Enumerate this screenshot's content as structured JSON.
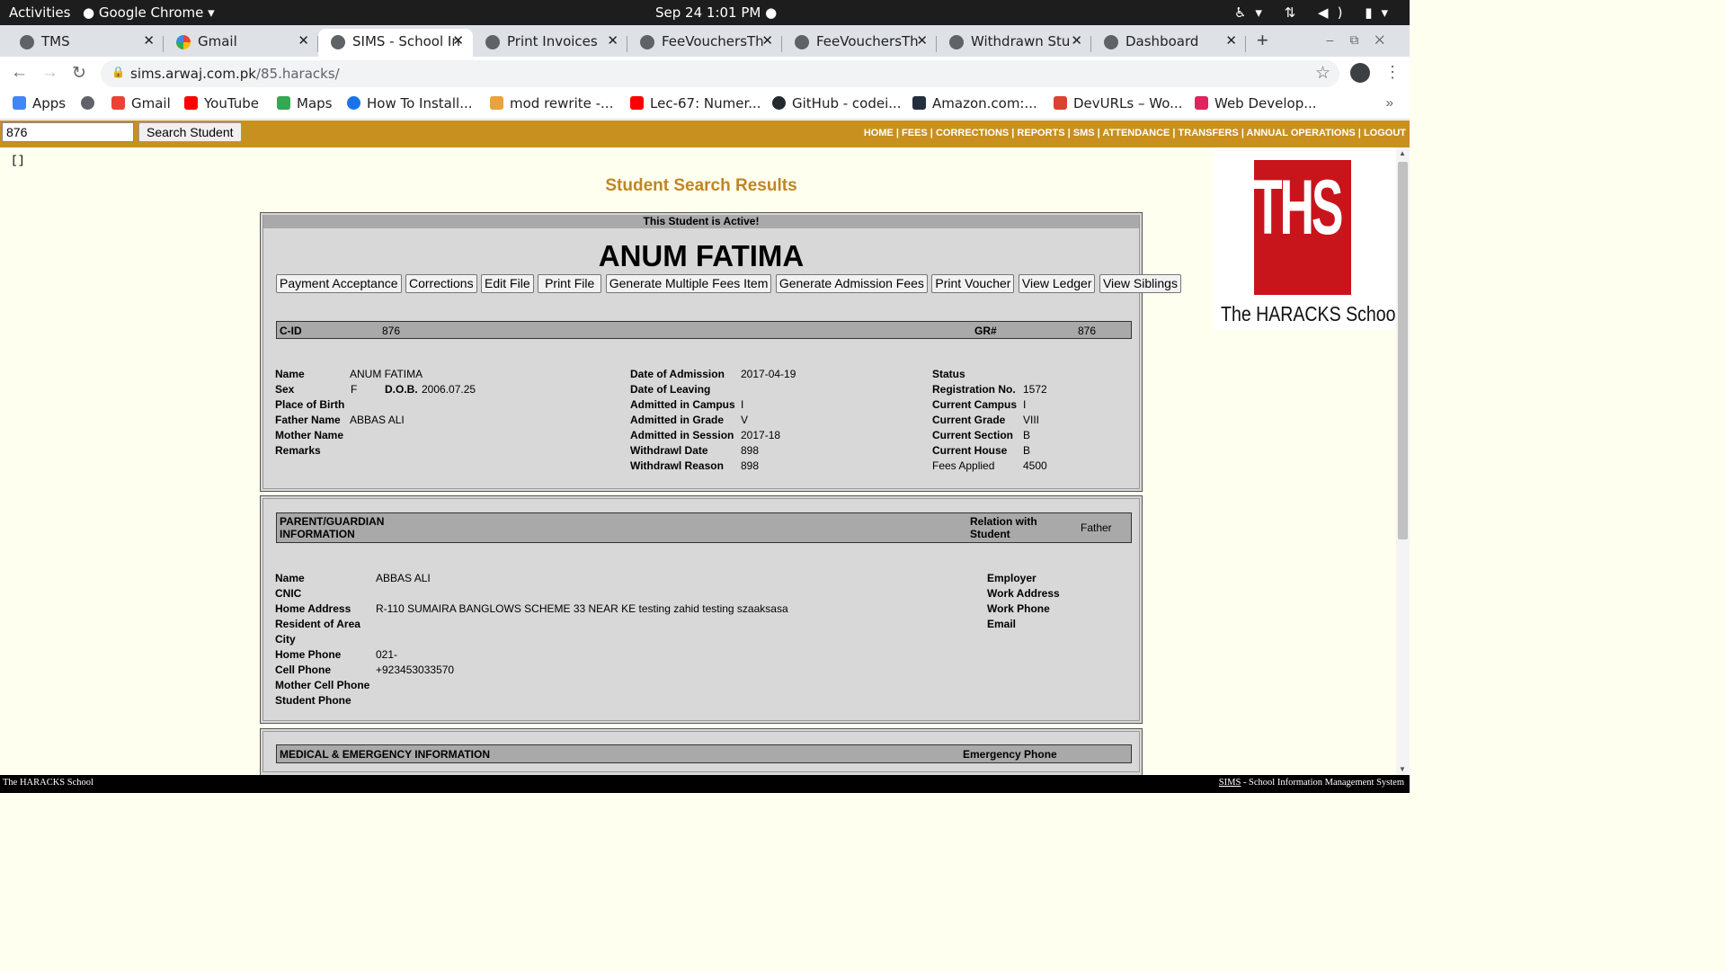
{
  "system": {
    "activities": "Activities",
    "app_name": "Google Chrome",
    "clock": "Sep 24  1:01 PM"
  },
  "browser": {
    "tabs": [
      {
        "label": "TMS",
        "icon": "globe-icon"
      },
      {
        "label": "Gmail",
        "icon": "google-icon"
      },
      {
        "label": "SIMS - School In",
        "icon": "globe-icon",
        "active": true
      },
      {
        "label": "Print Invoices",
        "icon": "globe-icon"
      },
      {
        "label": "FeeVouchersTh",
        "icon": "globe-icon"
      },
      {
        "label": "FeeVouchersTh",
        "icon": "globe-icon"
      },
      {
        "label": "Withdrawn Stu",
        "icon": "globe-icon"
      },
      {
        "label": "Dashboard",
        "icon": "globe-icon"
      }
    ],
    "url_host": "sims.arwaj.com.pk",
    "url_path": "/85.haracks/",
    "bookmarks": [
      {
        "label": "Apps",
        "color": "#4285f4"
      },
      {
        "label": "",
        "color": "#5f6368"
      },
      {
        "label": "Gmail",
        "color": "#ea4335"
      },
      {
        "label": "YouTube",
        "color": "#ff0000"
      },
      {
        "label": "Maps",
        "color": "#34a853"
      },
      {
        "label": "How To Install...",
        "color": "#1a73e8"
      },
      {
        "label": "mod rewrite -...",
        "color": "#e8a33d"
      },
      {
        "label": "Lec-67: Numer...",
        "color": "#ff0000"
      },
      {
        "label": "GitHub - codei...",
        "color": "#24292e"
      },
      {
        "label": "Amazon.com:...",
        "color": "#232f3e"
      },
      {
        "label": "DevURLs – Wo...",
        "color": "#d9432f"
      },
      {
        "label": "Web Develop...",
        "color": "#e0245e"
      }
    ],
    "bookmarks_more": "»"
  },
  "header": {
    "search_value": "876",
    "search_button": "Search Student",
    "nav": "HOME | FEES | CORRECTIONS | REPORTS | SMS | ATTENDANCE | TRANSFERS | ANNUAL OPERATIONS | LOGOUT",
    "brackets": "[]"
  },
  "logo": {
    "letters": "THS",
    "school": "The HARACKS School"
  },
  "page": {
    "title": "Student Search Results",
    "active_notice": "This Student is Active!",
    "student_name": "ANUM FATIMA",
    "actions": [
      "Payment Acceptance",
      "Corrections",
      "Edit File",
      "Print File",
      "Generate Multiple Fees Item",
      "Generate Admission Fees",
      "Print Voucher",
      "View Ledger",
      "View Siblings"
    ],
    "cid_label": "C-ID",
    "cid_value": "876",
    "gr_label": "GR#",
    "gr_value": "876",
    "col1": [
      {
        "label": "Name",
        "value": "ANUM FATIMA"
      },
      {
        "label": "Sex",
        "value": "F"
      },
      {
        "label": "Place of Birth",
        "value": ""
      },
      {
        "label": "Father Name",
        "value": "ABBAS ALI"
      },
      {
        "label": "Mother Name",
        "value": ""
      },
      {
        "label": "Remarks",
        "value": ""
      }
    ],
    "dob_label": "D.O.B.",
    "dob_value": "2006.07.25",
    "col2": [
      {
        "label": "Date of Admission",
        "value": "2017-04-19"
      },
      {
        "label": "Date of Leaving",
        "value": ""
      },
      {
        "label": "Admitted in Campus",
        "value": "I"
      },
      {
        "label": "Admitted in Grade",
        "value": "V"
      },
      {
        "label": "Admitted in Session",
        "value": "2017-18"
      },
      {
        "label": "Withdrawl Date",
        "value": "898"
      },
      {
        "label": "Withdrawl Reason",
        "value": "898"
      }
    ],
    "col3": [
      {
        "label": "Status",
        "value": ""
      },
      {
        "label": "Registration No.",
        "value": "1572"
      },
      {
        "label": "Current Campus",
        "value": "I"
      },
      {
        "label": "Current Grade",
        "value": "VIII"
      },
      {
        "label": "Current Section",
        "value": "B"
      },
      {
        "label": "Current House",
        "value": "B"
      },
      {
        "label": "Fees Applied",
        "value": "4500"
      }
    ]
  },
  "guardian": {
    "header_l1": "PARENT/GUARDIAN",
    "header_l2": "INFORMATION",
    "relation_l1": "Relation with",
    "relation_l2": "Student",
    "relation_value": "Father",
    "fields": [
      {
        "label": "Name",
        "value": "ABBAS ALI"
      },
      {
        "label": "CNIC",
        "value": ""
      },
      {
        "label": "Home Address",
        "value": "R-110 SUMAIRA BANGLOWS SCHEME 33 NEAR KE testing zahid testing szaaksasa"
      },
      {
        "label": "Resident of Area",
        "value": ""
      },
      {
        "label": "City",
        "value": ""
      },
      {
        "label": "Home Phone",
        "value": "021-"
      },
      {
        "label": "Cell Phone",
        "value": "+923453033570"
      },
      {
        "label": "Mother Cell Phone",
        "value": ""
      },
      {
        "label": "Student Phone",
        "value": ""
      }
    ],
    "right_fields": [
      "Employer",
      "Work Address",
      "Work Phone",
      "Email"
    ]
  },
  "medical": {
    "header": "MEDICAL & EMERGENCY INFORMATION",
    "emergency": "Emergency Phone"
  },
  "footer": {
    "left": "The HARACKS School",
    "right_link": "SIMS",
    "right_text": " - School Information Management System"
  }
}
